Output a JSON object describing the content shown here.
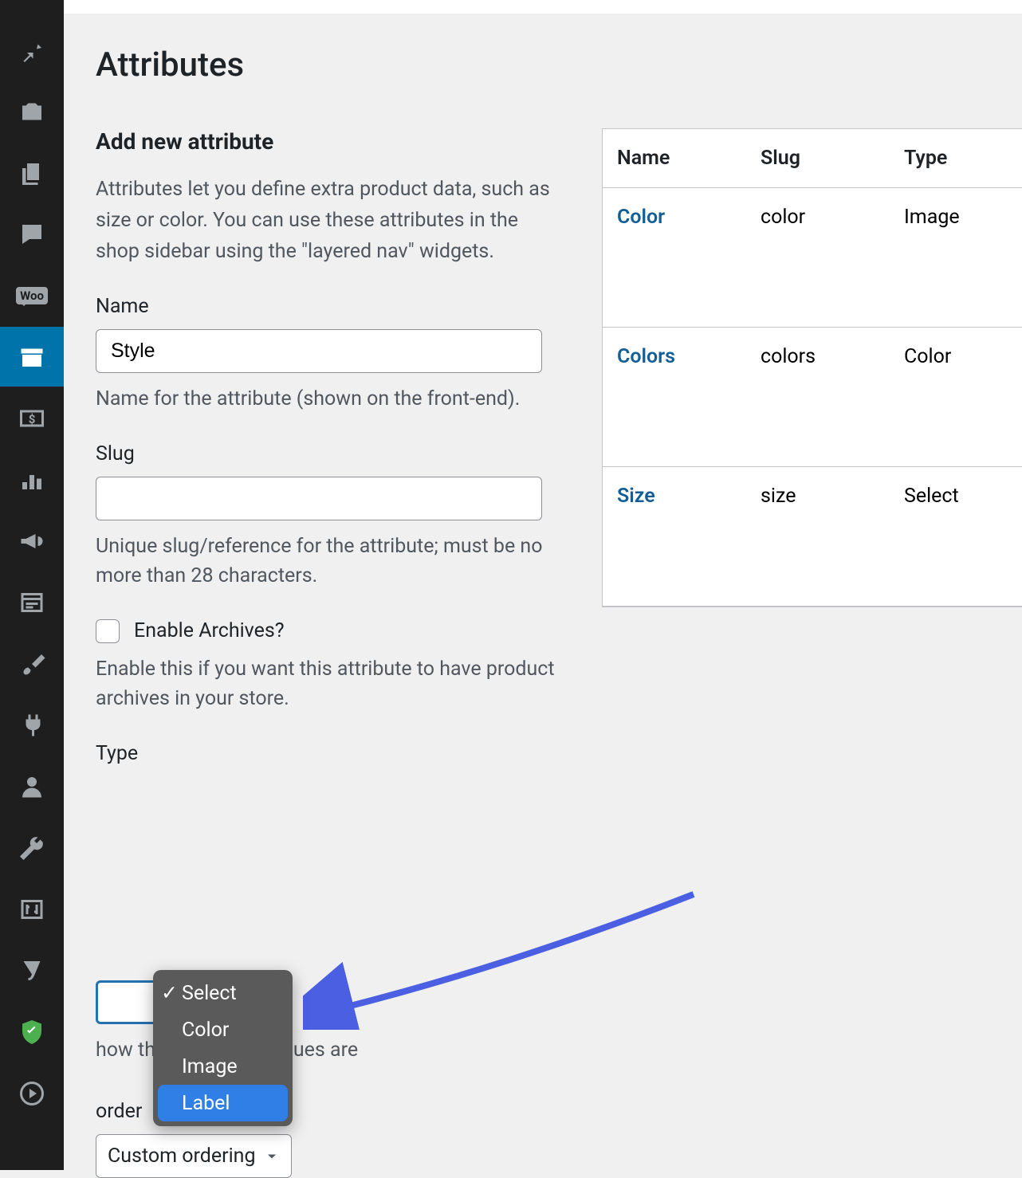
{
  "page": {
    "title": "Attributes"
  },
  "form": {
    "heading": "Add new attribute",
    "intro": "Attributes let you define extra product data, such as size or color. You can use these attributes in the shop sidebar using the \"layered nav\" widgets.",
    "name": {
      "label": "Name",
      "value": "Style",
      "help": "Name for the attribute (shown on the front-end)."
    },
    "slug": {
      "label": "Slug",
      "value": "",
      "help": "Unique slug/reference for the attribute; must be no more than 28 characters."
    },
    "archives": {
      "label": "Enable Archives?",
      "help": "Enable this if you want this attribute to have product archives in your store."
    },
    "type": {
      "label": "Type",
      "help_visible": "how this attribute's values are",
      "options": [
        "Select",
        "Color",
        "Image",
        "Label"
      ],
      "selected": "Select",
      "highlighted": "Label"
    },
    "sort": {
      "label_visible": "order",
      "value": "Custom ordering"
    }
  },
  "table": {
    "headers": {
      "name": "Name",
      "slug": "Slug",
      "type": "Type"
    },
    "rows": [
      {
        "name": "Color",
        "slug": "color",
        "type": "Image"
      },
      {
        "name": "Colors",
        "slug": "colors",
        "type": "Color"
      },
      {
        "name": "Size",
        "slug": "size",
        "type": "Select"
      }
    ]
  },
  "sidebar": {
    "woo": "Woo"
  }
}
